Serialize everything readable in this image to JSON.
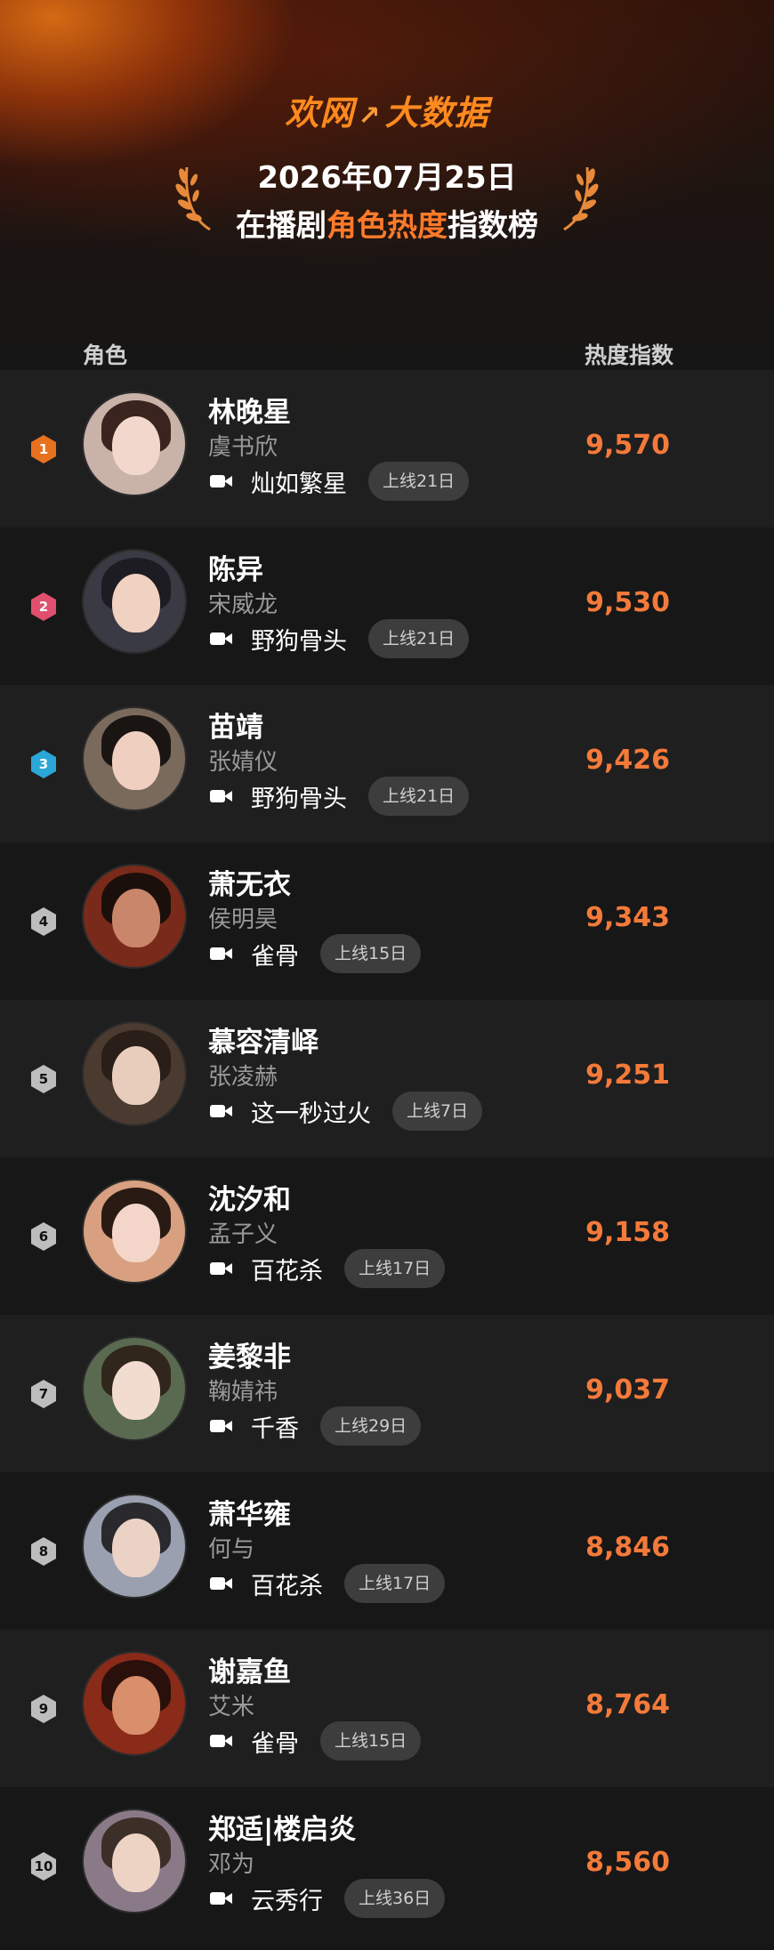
{
  "header": {
    "logo_part1": "欢网",
    "logo_part2": "大数据",
    "date": "2026年07月25日",
    "subtitle_pre": "在播剧",
    "subtitle_highlight": "角色热度",
    "subtitle_post": "指数榜",
    "accent_color": "#ff7a2a"
  },
  "columns": {
    "role": "角色",
    "heat": "热度指数"
  },
  "rows": [
    {
      "rank": "1",
      "name": "林晚星",
      "actor": "虞书欣",
      "show": "灿如繁星",
      "online": "上线21日",
      "score": "9,570",
      "medal": "#e8711f"
    },
    {
      "rank": "2",
      "name": "陈异",
      "actor": "宋威龙",
      "show": "野狗骨头",
      "online": "上线21日",
      "score": "9,530",
      "medal": "#e0506e"
    },
    {
      "rank": "3",
      "name": "苗靖",
      "actor": "张婧仪",
      "show": "野狗骨头",
      "online": "上线21日",
      "score": "9,426",
      "medal": "#2aa7d6"
    },
    {
      "rank": "4",
      "name": "萧无衣",
      "actor": "侯明昊",
      "show": "雀骨",
      "online": "上线15日",
      "score": "9,343",
      "medal": "#bdbdbd"
    },
    {
      "rank": "5",
      "name": "慕容清峄",
      "actor": "张凌赫",
      "show": "这一秒过火",
      "online": "上线7日",
      "score": "9,251",
      "medal": "#bdbdbd"
    },
    {
      "rank": "6",
      "name": "沈汐和",
      "actor": "孟子义",
      "show": "百花杀",
      "online": "上线17日",
      "score": "9,158",
      "medal": "#bdbdbd"
    },
    {
      "rank": "7",
      "name": "姜黎非",
      "actor": "鞠婧祎",
      "show": "千香",
      "online": "上线29日",
      "score": "9,037",
      "medal": "#bdbdbd"
    },
    {
      "rank": "8",
      "name": "萧华雍",
      "actor": "何与",
      "show": "百花杀",
      "online": "上线17日",
      "score": "8,846",
      "medal": "#bdbdbd"
    },
    {
      "rank": "9",
      "name": "谢嘉鱼",
      "actor": "艾米",
      "show": "雀骨",
      "online": "上线15日",
      "score": "8,764",
      "medal": "#bdbdbd"
    },
    {
      "rank": "10",
      "name": "郑适|楼启炎",
      "actor": "邓为",
      "show": "云秀行",
      "online": "上线36日",
      "score": "8,560",
      "medal": "#bdbdbd"
    }
  ]
}
